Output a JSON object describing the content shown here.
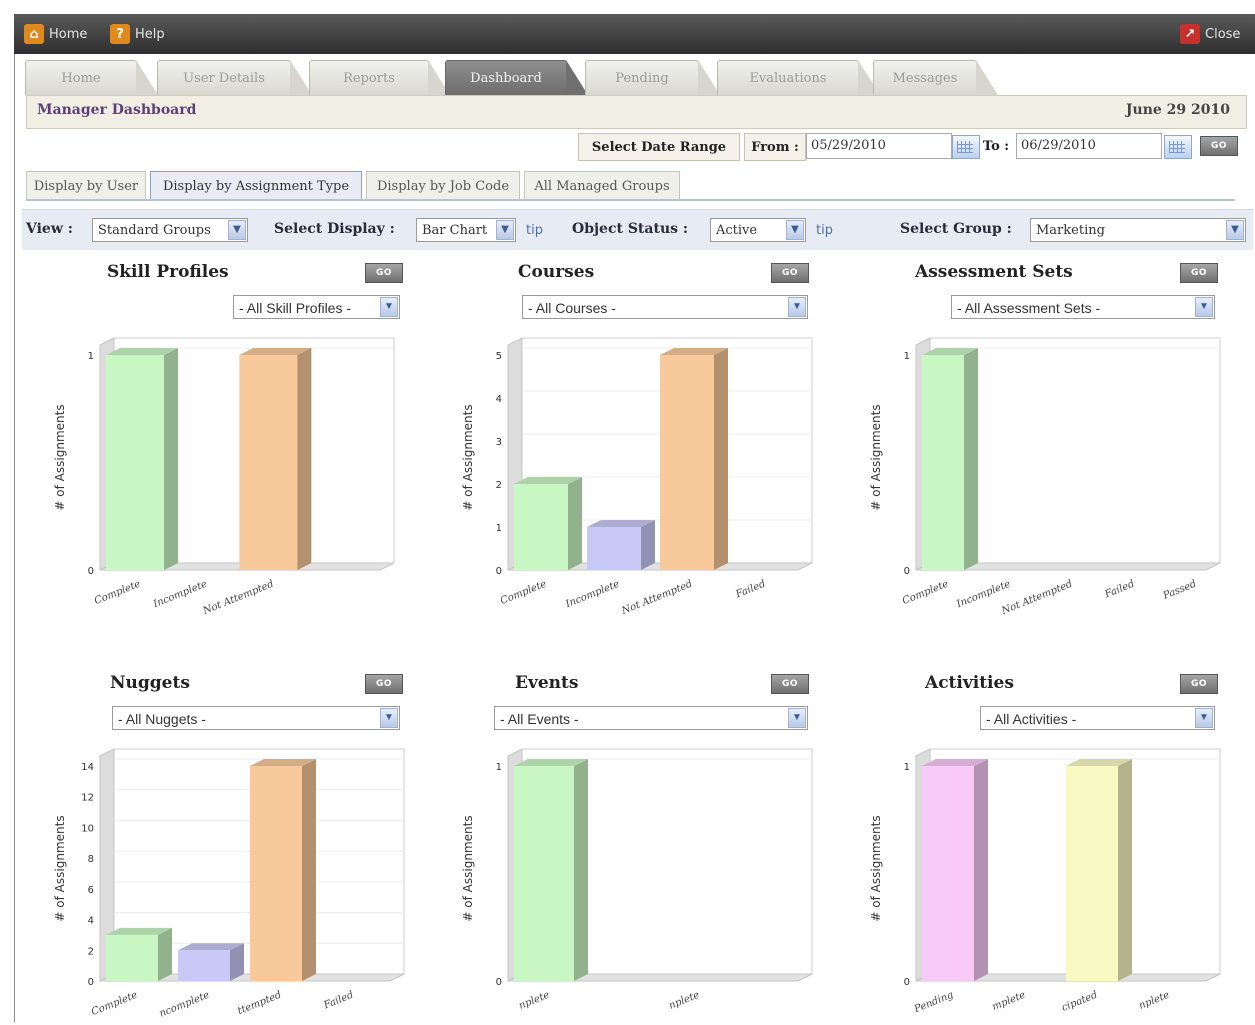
{
  "topbar": {
    "home_label": "Home",
    "help_label": "Help",
    "close_label": "Close"
  },
  "tabs": [
    "Home",
    "User Details",
    "Reports",
    "Dashboard",
    "Pending",
    "Evaluations",
    "Messages"
  ],
  "active_tab": "Dashboard",
  "header": {
    "title": "Manager Dashboard",
    "date": "June 29 2010"
  },
  "date_range": {
    "label": "Select Date Range",
    "from_label": "From :",
    "from_value": "05/29/2010",
    "to_label": "To :",
    "to_value": "06/29/2010",
    "go_label": "GO"
  },
  "display_tabs": [
    "Display by User",
    "Display by Assignment Type",
    "Display by Job Code",
    "All Managed Groups"
  ],
  "active_display_tab": "Display by Assignment Type",
  "filters": {
    "view_label": "View :",
    "view_value": "Standard Groups",
    "display_label": "Select Display :",
    "display_value": "Bar Chart",
    "tip_label": "tip",
    "status_label": "Object Status :",
    "status_value": "Active",
    "group_label": "Select Group :",
    "group_value": "Marketing"
  },
  "panels": [
    {
      "title": "Skill Profiles",
      "go": "GO",
      "select": "- All Skill Profiles -"
    },
    {
      "title": "Courses",
      "go": "GO",
      "select": "- All Courses -"
    },
    {
      "title": "Assessment Sets",
      "go": "GO",
      "select": "- All Assessment Sets -"
    },
    {
      "title": "Nuggets",
      "go": "GO",
      "select": "- All Nuggets -"
    },
    {
      "title": "Events",
      "go": "GO",
      "select": "- All Events -"
    },
    {
      "title": "Activities",
      "go": "GO",
      "select": "- All Activities -"
    }
  ],
  "colors": {
    "complete": "#c9f7c4",
    "incomplete": "#c9c9f7",
    "not_attempted": "#f8c99a",
    "pending": "#f9c9f7",
    "participated": "#f9f9c4"
  },
  "chart_data": [
    {
      "type": "bar",
      "title": "Skill Profiles",
      "ylabel": "# of Assignments",
      "categories": [
        "Complete",
        "Incomplete",
        "Not Attempted"
      ],
      "values": [
        1,
        0,
        1
      ],
      "yticks": [
        0,
        1
      ],
      "ylim": [
        0,
        1
      ],
      "colors": [
        "#c9f7c4",
        "#c9c9f7",
        "#f8c99a"
      ]
    },
    {
      "type": "bar",
      "title": "Courses",
      "ylabel": "# of Assignments",
      "categories": [
        "Complete",
        "Incomplete",
        "Not Attempted",
        "Failed"
      ],
      "values": [
        2,
        1,
        5,
        0
      ],
      "yticks": [
        0,
        1,
        2,
        3,
        4,
        5
      ],
      "ylim": [
        0,
        5
      ],
      "colors": [
        "#c9f7c4",
        "#c9c9f7",
        "#f8c99a",
        "#f9c9c9"
      ]
    },
    {
      "type": "bar",
      "title": "Assessment Sets",
      "ylabel": "# of Assignments",
      "categories": [
        "Complete",
        "Incomplete",
        "Not Attempted",
        "Failed",
        "Passed"
      ],
      "values": [
        1,
        0,
        0,
        0,
        0
      ],
      "yticks": [
        0,
        1
      ],
      "ylim": [
        0,
        1
      ],
      "colors": [
        "#c9f7c4",
        "#c9c9f7",
        "#f8c99a",
        "#f9c9c9",
        "#c4e9f7"
      ]
    },
    {
      "type": "bar",
      "title": "Nuggets",
      "ylabel": "# of Assignments",
      "categories": [
        "Complete",
        "Incomplete",
        "Not Attempted",
        "Failed"
      ],
      "tick_labels_visible": [
        "Complete",
        "ncomplete",
        "ttempted",
        "Failed"
      ],
      "values": [
        3,
        2,
        14,
        0
      ],
      "yticks": [
        0,
        2,
        4,
        6,
        8,
        10,
        12,
        14
      ],
      "ylim": [
        0,
        14
      ],
      "colors": [
        "#c9f7c4",
        "#c9c9f7",
        "#f8c99a",
        "#f9c9c9"
      ]
    },
    {
      "type": "bar",
      "title": "Events",
      "ylabel": "# of Assignments",
      "categories": [
        "Complete",
        "Incomplete"
      ],
      "tick_labels_visible": [
        "nplete",
        "nplete"
      ],
      "values": [
        1,
        0
      ],
      "yticks": [
        0,
        1
      ],
      "ylim": [
        0,
        1
      ],
      "colors": [
        "#c9f7c4",
        "#c9c9f7"
      ]
    },
    {
      "type": "bar",
      "title": "Activities",
      "ylabel": "# of Assignments",
      "categories": [
        "Pending",
        "Complete",
        "Participated",
        "Incomplete"
      ],
      "tick_labels_visible": [
        "Pending",
        "mplete",
        "cipated",
        "nplete"
      ],
      "values": [
        1,
        0,
        1,
        0
      ],
      "yticks": [
        0,
        1
      ],
      "ylim": [
        0,
        1
      ],
      "colors": [
        "#f9c9f7",
        "#c9f7c4",
        "#f9f9c4",
        "#c9c9f7"
      ]
    }
  ]
}
